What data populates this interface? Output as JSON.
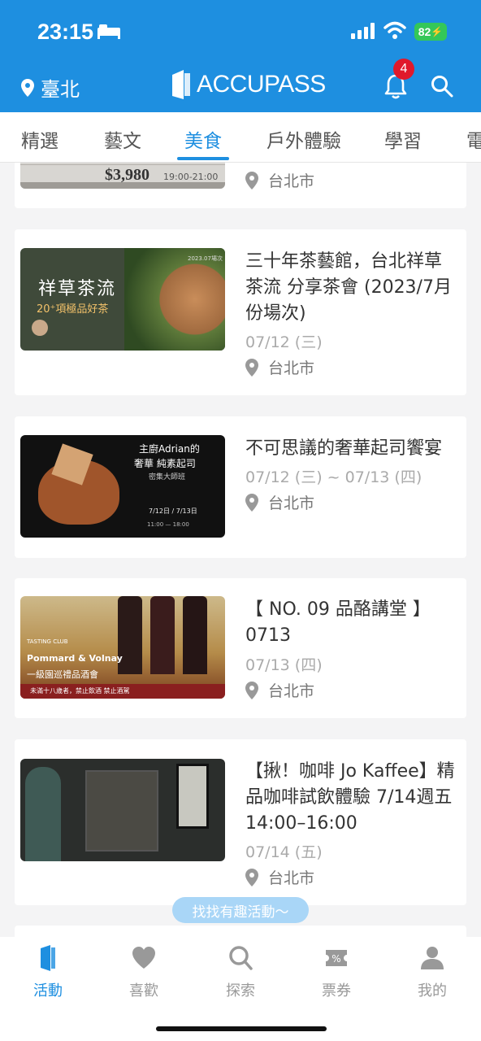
{
  "status": {
    "time": "23:15",
    "battery": "82"
  },
  "header": {
    "location": "臺北",
    "brand": "ACCUPASS",
    "notification_count": "4"
  },
  "tabs": [
    {
      "label": "精選"
    },
    {
      "label": "藝文"
    },
    {
      "label": "美食",
      "active": true
    },
    {
      "label": "戶外體驗"
    },
    {
      "label": "學習"
    },
    {
      "label": "電"
    }
  ],
  "events": [
    {
      "title": "",
      "date": "",
      "city": "台北市",
      "thumb_text": {
        "price": "$3,980",
        "time": "19:00-21:00"
      }
    },
    {
      "title": "三十年茶藝館，台北祥草茶流 分享茶會 (2023/7月份場次)",
      "date": "07/12 (三)",
      "city": "台北市",
      "thumb_text": {
        "headline": "祥草茶流",
        "sub": "20⁺項極品好茶",
        "tag": "2023.07場次"
      }
    },
    {
      "title": "不可思議的奢華起司饗宴",
      "date": "07/12 (三) ~ 07/13 (四)",
      "city": "台北市",
      "thumb_text": {
        "line1": "主廚Adrian的",
        "line2": "奢華 純素起司",
        "line3": "密集大師班",
        "dates": "7/12日 / 7/13日",
        "hours": "11:00 — 18:00"
      }
    },
    {
      "title": "【 NO. 09 品酪講堂 】0713",
      "date": "07/13 (四)",
      "city": "台北市",
      "thumb_text": {
        "club": "TASTING CLUB",
        "wine": "Pommard & Volnay",
        "sub": "一級園巡禮品酒會",
        "warn": "未滿十八歲者，禁止飲酒 禁止酒駕"
      }
    },
    {
      "title": "【揪！咖啡 Jo Kaffee】精品咖啡試飲體驗 7/14週五 14:00–16:00",
      "date": "07/14 (五)",
      "city": "台北市",
      "thumb_text": {}
    }
  ],
  "toast": "找找有趣活動～",
  "bottom_nav": [
    {
      "label": "活動",
      "icon": "door-icon",
      "active": true
    },
    {
      "label": "喜歡",
      "icon": "heart-icon"
    },
    {
      "label": "探索",
      "icon": "search-icon"
    },
    {
      "label": "票券",
      "icon": "ticket-icon"
    },
    {
      "label": "我的",
      "icon": "person-icon"
    }
  ],
  "colors": {
    "brand": "#1e8fe0",
    "badge": "#e0192b",
    "battery": "#34c759"
  }
}
